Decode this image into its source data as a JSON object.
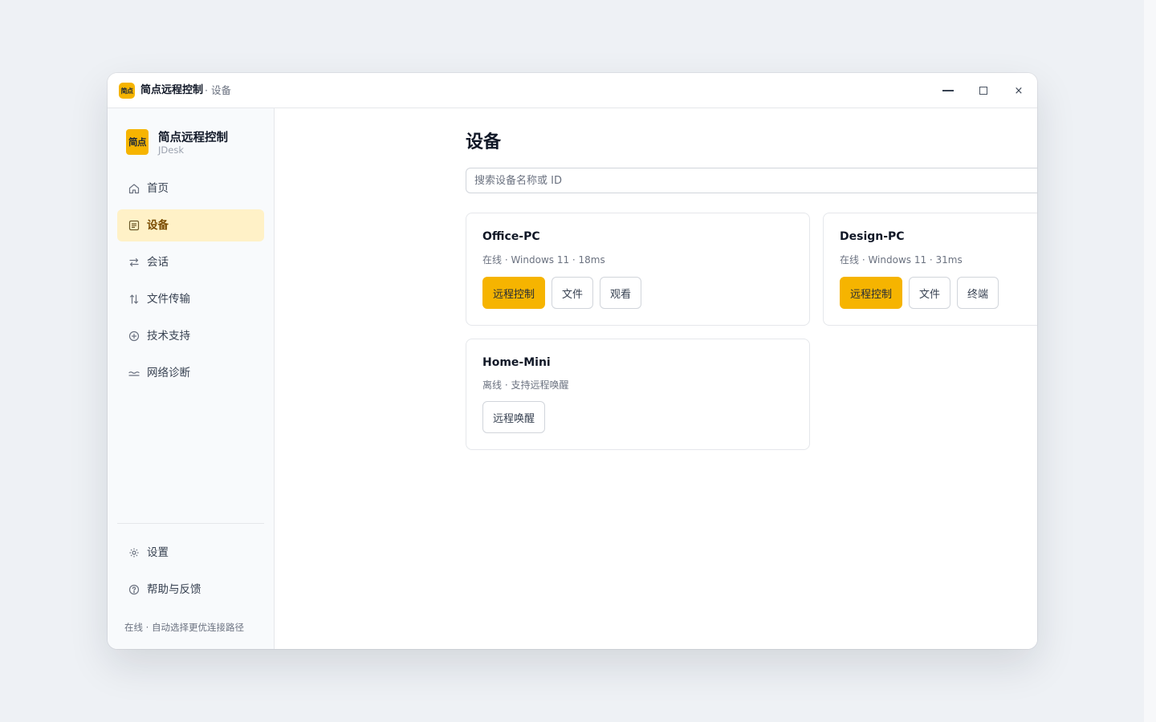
{
  "window": {
    "app_title": "简点远程控制",
    "page_crumb": "· 设备",
    "logo_text": "简点",
    "controls": {
      "minimize": "minimize-icon",
      "maximize": "maximize-icon",
      "close": "×"
    }
  },
  "sidebar": {
    "brand_logo": "简点",
    "brand_name": "简点远程控制",
    "brand_sub": "JDesk",
    "items": [
      {
        "label": "首页",
        "icon": "home-icon",
        "active": false
      },
      {
        "label": "设备",
        "icon": "device-list-icon",
        "active": true
      },
      {
        "label": "会话",
        "icon": "swap-arrows-icon",
        "active": false
      },
      {
        "label": "文件传输",
        "icon": "transfer-icon",
        "active": false
      },
      {
        "label": "技术支持",
        "icon": "support-plus-icon",
        "active": false
      },
      {
        "label": "网络诊断",
        "icon": "network-wave-icon",
        "active": false
      }
    ],
    "bottom_items": [
      {
        "label": "设置",
        "icon": "gear-icon"
      },
      {
        "label": "帮助与反馈",
        "icon": "help-icon"
      }
    ],
    "status": "在线 · 自动选择更优连接路径"
  },
  "main": {
    "title": "设备",
    "search": {
      "placeholder": "搜索设备名称或 ID",
      "value": ""
    },
    "devices": [
      {
        "name": "Office-PC",
        "status": "在线 · Windows 11 · 18ms",
        "actions": [
          "远程控制",
          "文件",
          "观看"
        ]
      },
      {
        "name": "Design-PC",
        "status": "在线 · Windows 11 · 31ms",
        "actions": [
          "远程控制",
          "文件",
          "终端"
        ]
      },
      {
        "name": "Home-Mini",
        "status": "离线 · 支持远程唤醒",
        "actions": [
          "远程唤醒"
        ]
      }
    ]
  },
  "colors": {
    "accent": "#f6b400",
    "active_nav_bg": "#fff1c7",
    "active_nav_text": "#7a4b00",
    "background": "#eef1f5"
  }
}
